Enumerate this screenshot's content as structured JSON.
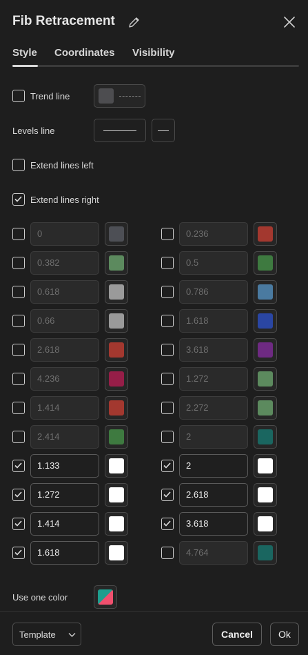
{
  "dialog": {
    "title": "Fib Retracement",
    "icons": {
      "edit": "pencil-icon",
      "close": "close-icon"
    }
  },
  "tabs": [
    {
      "label": "Style",
      "active": true
    },
    {
      "label": "Coordinates",
      "active": false
    },
    {
      "label": "Visibility",
      "active": false
    }
  ],
  "style": {
    "trend_line": {
      "label": "Trend line",
      "checked": false,
      "color": "#4d4d50"
    },
    "levels_line": {
      "label": "Levels line"
    },
    "extend_left": {
      "label": "Extend lines left",
      "checked": false
    },
    "extend_right": {
      "label": "Extend lines right",
      "checked": true
    },
    "use_one_color": {
      "label": "Use one color"
    }
  },
  "levels_left": [
    {
      "value": "0",
      "checked": false,
      "color": "#4d4f55"
    },
    {
      "value": "0.382",
      "checked": false,
      "color": "#5c8a5e"
    },
    {
      "value": "0.618",
      "checked": false,
      "color": "#9a9a9a"
    },
    {
      "value": "0.66",
      "checked": false,
      "color": "#9a9a9a"
    },
    {
      "value": "2.618",
      "checked": false,
      "color": "#a3382f"
    },
    {
      "value": "4.236",
      "checked": false,
      "color": "#961e48"
    },
    {
      "value": "1.414",
      "checked": false,
      "color": "#a3382f"
    },
    {
      "value": "2.414",
      "checked": false,
      "color": "#3e7a40"
    },
    {
      "value": "1.133",
      "checked": true,
      "color": "#ffffff"
    },
    {
      "value": "1.272",
      "checked": true,
      "color": "#ffffff"
    },
    {
      "value": "1.414",
      "checked": true,
      "color": "#ffffff"
    },
    {
      "value": "1.618",
      "checked": true,
      "color": "#ffffff"
    }
  ],
  "levels_right": [
    {
      "value": "0.236",
      "checked": false,
      "color": "#a3382f"
    },
    {
      "value": "0.5",
      "checked": false,
      "color": "#3e7a40"
    },
    {
      "value": "0.786",
      "checked": false,
      "color": "#4a7aa0"
    },
    {
      "value": "1.618",
      "checked": false,
      "color": "#2a46a3"
    },
    {
      "value": "3.618",
      "checked": false,
      "color": "#6e2a82"
    },
    {
      "value": "1.272",
      "checked": false,
      "color": "#5c8a5e"
    },
    {
      "value": "2.272",
      "checked": false,
      "color": "#5c8a5e"
    },
    {
      "value": "2",
      "checked": false,
      "color": "#1a6660"
    },
    {
      "value": "2",
      "checked": true,
      "color": "#ffffff"
    },
    {
      "value": "2.618",
      "checked": true,
      "color": "#ffffff"
    },
    {
      "value": "3.618",
      "checked": true,
      "color": "#ffffff"
    },
    {
      "value": "4.764",
      "checked": false,
      "color": "#1a6660"
    }
  ],
  "footer": {
    "template_label": "Template",
    "cancel_label": "Cancel",
    "ok_label": "Ok"
  }
}
